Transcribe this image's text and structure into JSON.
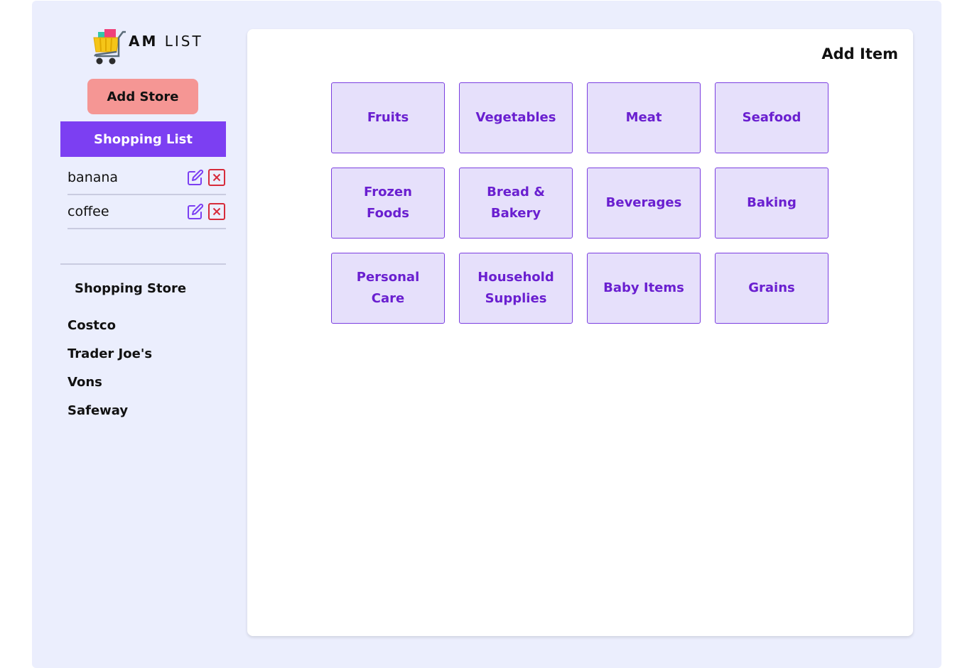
{
  "logo": {
    "icon": "shopping-cart-icon",
    "text_bold": "AM",
    "text_regular": "LIST"
  },
  "sidebar": {
    "add_store_label": "Add Store",
    "list_title": "Shopping List",
    "list_items": [
      {
        "label": "banana",
        "edit_icon": "edit-icon",
        "delete_icon": "delete-icon"
      },
      {
        "label": "coffee",
        "edit_icon": "edit-icon",
        "delete_icon": "delete-icon"
      }
    ],
    "store_heading": "Shopping Store",
    "stores": [
      "Costco",
      "Trader Joe's",
      "Vons",
      "Safeway"
    ]
  },
  "main": {
    "title": "Add Item",
    "categories": [
      "Fruits",
      "Vegetables",
      "Meat",
      "Seafood",
      "Frozen Foods",
      "Bread & Bakery",
      "Beverages",
      "Baking",
      "Personal Care",
      "Household Supplies",
      "Baby Items",
      "Grains"
    ]
  },
  "colors": {
    "background": "#ebeefd",
    "accent": "#7c3ff2",
    "add_store": "#f59694",
    "tile_bg": "#e6e0fb",
    "tile_text": "#6a1fd0",
    "edit_icon": "#7c3ff2",
    "delete_icon": "#d62b3a"
  }
}
